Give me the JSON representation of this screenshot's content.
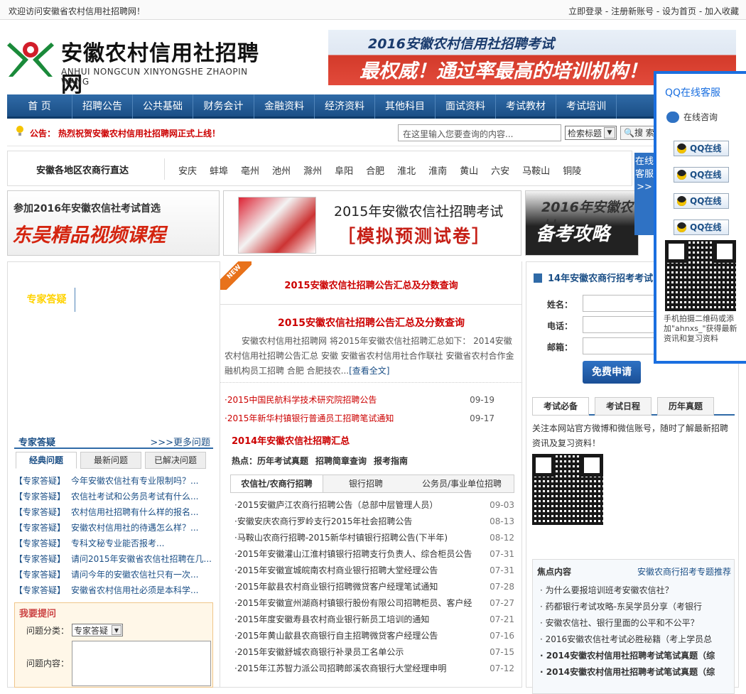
{
  "topbar": {
    "welcome": "欢迎访问安徽省农村信用社招聘网！",
    "links": "立即登录 - 注册新账号 - 设为首页 - 加入收藏"
  },
  "logo": {
    "cn": "安徽农村信用社招聘网",
    "en": "ANHUI NONGCUN XINYONGSHE ZHAOPIN WANG"
  },
  "banner": {
    "line1": "2016安徽农村信用社招聘考试",
    "line2": "最权威！通过率最高的培训机构！"
  },
  "nav": [
    "首 页",
    "招聘公告",
    "公共基础",
    "财务会计",
    "金融资料",
    "经济资料",
    "其他科目",
    "面试资料",
    "考试教材",
    "考试培训",
    "专家答疑"
  ],
  "notice": {
    "label": "公告：",
    "text": "热烈祝贺安徽农村信用社招聘网正式上线！"
  },
  "search": {
    "placeholder": "在这里输入您要查询的内容...",
    "select": "检索标题",
    "button": "搜 索"
  },
  "region": {
    "title": "安徽各地区农商行直达",
    "cities": [
      "安庆",
      "蚌埠",
      "亳州",
      "池州",
      "滁州",
      "阜阳",
      "合肥",
      "淮北",
      "淮南",
      "黄山",
      "六安",
      "马鞍山",
      "铜陵"
    ]
  },
  "ads": {
    "a1_small": "参加2016年安徽农信社考试首选",
    "a1_big": "东吴精品视频课程",
    "a2_small": "2015年安徽农信社招聘考试",
    "a2_big": "［模拟预测试卷］",
    "a3_small": "2016年安徽农村",
    "a3_big": "备考攻略"
  },
  "faq": {
    "title": "专家答疑",
    "more": ">>>更多问题",
    "tabs": [
      "经典问题",
      "最新问题",
      "已解决问题"
    ],
    "tag": "【专家答疑】",
    "items": [
      "今年安徽农信社有专业限制吗？...",
      "农信社考试和公务员考试有什么...",
      "农村信用社招聘有什么样的报名...",
      "安徽农村信用社的待遇怎么样？...",
      "专科文秘专业能否报考...",
      "请问2015年安徽省农信社招聘在几...",
      "请问今年的安徽农信社只有一次...",
      "安徽省农村信用社必须是本科学..."
    ]
  },
  "ask": {
    "title": "我要提问",
    "cat_label": "问题分类：",
    "cat_value": "专家答疑",
    "content_label": "问题内容："
  },
  "mid": {
    "newtag": "NEW",
    "headline": "2015安徽农信社招聘公告汇总及分数查询",
    "title": "2015安徽农信社招聘公告汇总及分数查询",
    "summary": "安徽农村信用社招聘网 将2015年安徽农信社招聘汇总如下： 2014安徽农村信用社招聘公告汇总 安徽 安徽省农村信用社合作联社 安徽省农村合作金融机构员工招聘 合肥 合肥技农...",
    "more": "[查看全文]",
    "red_news": [
      {
        "t": "2015中国民航科学技术研究院招聘公告",
        "d": "09-19"
      },
      {
        "t": "2015年新华村镇银行普通员工招聘笔试通知",
        "d": "09-17"
      }
    ],
    "section": "2014年安徽农信社招聘汇总",
    "hot": [
      "热点：历年考试真题",
      "招聘简章查询",
      "报考指南"
    ],
    "tabs": [
      "农信社/农商行招聘",
      "银行招聘",
      "公务员/事业单位招聘"
    ],
    "list": [
      {
        "t": "2015安徽庐江农商行招聘公告（总部中层管理人员）",
        "d": "09-03"
      },
      {
        "t": "安徽安庆农商行罗岭支行2015年社会招聘公告",
        "d": "08-13"
      },
      {
        "t": "马鞍山农商行招聘-2015新华村镇银行招聘公告(下半年)",
        "d": "08-12"
      },
      {
        "t": "2015年安徽灌山江淮村镇银行招聘支行负责人、综合柜员公告",
        "d": "07-31"
      },
      {
        "t": "2015年安徽宣城皖南农村商业银行招聘大堂经理公告",
        "d": "07-31"
      },
      {
        "t": "2015年歙县农村商业银行招聘微贷客户经理笔试通知",
        "d": "07-28"
      },
      {
        "t": "2015年安徽宣州湖商村镇银行股份有限公司招聘柜员、客户经",
        "d": "07-27"
      },
      {
        "t": "2015年度安徽寿县农村商业银行新员工培训的通知",
        "d": "07-21"
      },
      {
        "t": "2015年黄山歙县农商银行自主招聘微贷客户经理公告",
        "d": "07-16"
      },
      {
        "t": "2015年安徽舒城农商银行补录员工名单公示",
        "d": "07-15"
      },
      {
        "t": "2015年江苏智力派公司招聘郎溪农商银行大堂经理申明",
        "d": "07-12"
      }
    ]
  },
  "right": {
    "title": "14年安徽农商行招考考试内部",
    "name": "姓名：",
    "phone": "电话：",
    "mail": "邮箱：",
    "submit": "免费申请",
    "tabs": [
      "考试必备",
      "考试日程",
      "历年真题"
    ],
    "text": "关注本网站官方微博和微信账号，随时了解最新招聘资讯及复习资料！",
    "focus_title": "焦点内容",
    "focus_more": "安徽农商行招考专题推荐",
    "focus": [
      {
        "t": "为什么要报培训班考安徽农信社？",
        "b": false
      },
      {
        "t": "药都银行考试攻略-东吴学员分享（考银行",
        "b": false
      },
      {
        "t": "安徽农信社、银行里面的公平和不公平？",
        "b": false
      },
      {
        "t": "2016安徽农信社考试必胜秘籍（考上学员总",
        "b": false
      },
      {
        "t": "2014安徽农村信用社招聘考试笔试真题（综",
        "b": true
      },
      {
        "t": "2014安徽农村信用社招聘考试笔试真题（综",
        "b": true
      }
    ]
  },
  "side": {
    "tab": "在线客服>>"
  },
  "qq": {
    "title": "QQ在线客服",
    "consult": "在线咨询",
    "btn": "QQ在线",
    "tip": "手机拍摄二维码或添加\"ahnxs_\"获得最新资讯和复习资料"
  }
}
